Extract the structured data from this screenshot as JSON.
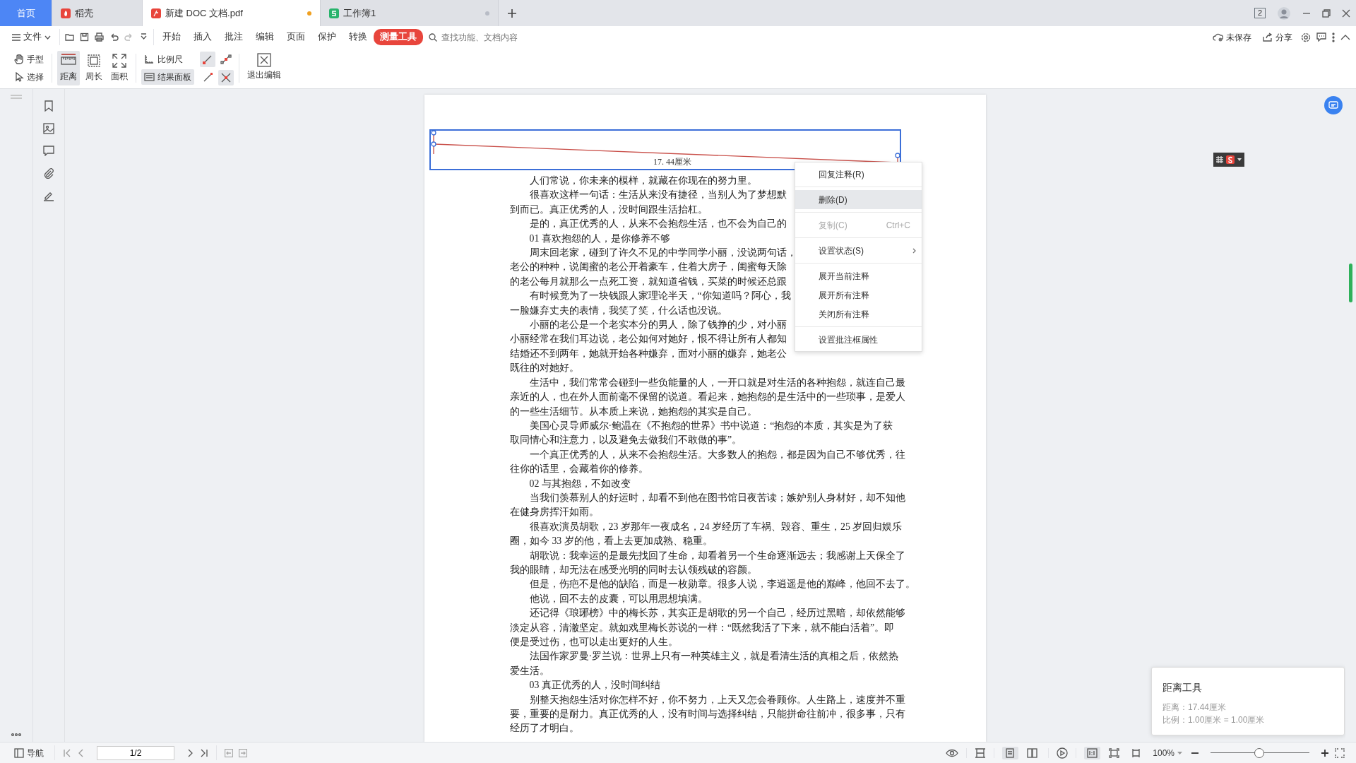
{
  "tabs": [
    {
      "label": "首页",
      "kind": "home",
      "selected": false,
      "unsaved": false
    },
    {
      "label": "稻壳",
      "kind": "docer",
      "selected": false,
      "unsaved": false
    },
    {
      "label": "新建 DOC 文档.pdf",
      "kind": "pdf",
      "selected": true,
      "unsaved": true
    },
    {
      "label": "工作簿1",
      "kind": "sheet",
      "selected": false,
      "unsaved": true
    }
  ],
  "window": {
    "count": "2"
  },
  "menu": {
    "file": "文件",
    "items": [
      {
        "label": "开始",
        "selected": false
      },
      {
        "label": "插入",
        "selected": false
      },
      {
        "label": "批注",
        "selected": false
      },
      {
        "label": "编辑",
        "selected": false
      },
      {
        "label": "页面",
        "selected": false
      },
      {
        "label": "保护",
        "selected": false
      },
      {
        "label": "转换",
        "selected": false
      },
      {
        "label": "测量工具",
        "selected": true
      }
    ],
    "search": {
      "placeholder": "查找功能、文档内容"
    },
    "save_state": "未保存",
    "share": "分享"
  },
  "ribbon": {
    "modes": [
      {
        "label": "手型",
        "kind": "hand",
        "selected": false
      },
      {
        "label": "选择",
        "kind": "select",
        "selected": false
      }
    ],
    "tools": [
      {
        "label": "距离",
        "kind": "distance",
        "selected": true
      },
      {
        "label": "周长",
        "kind": "perimeter",
        "selected": false
      },
      {
        "label": "面积",
        "kind": "area",
        "selected": false
      }
    ],
    "options": [
      {
        "label": "比例尺",
        "kind": "scale",
        "selected": false
      },
      {
        "label": "结果面板",
        "kind": "panel",
        "selected": true
      }
    ],
    "snaps": [
      {
        "kind": "endpoint",
        "selected": true
      },
      {
        "kind": "midpoint",
        "selected": false
      },
      {
        "kind": "path",
        "selected": false
      },
      {
        "kind": "intersection",
        "selected": true
      }
    ],
    "exit": "退出编辑"
  },
  "document": {
    "measurement": {
      "label": "17. 44厘米"
    },
    "paragraphs": [
      {
        "lines": [
          "人们常说，你未来的模样，就藏在你现在的努力里。"
        ]
      },
      {
        "lines": [
          "很喜欢这样一句话：生活从来没有捷径，当别人为了梦想默",
          "到而已。真正优秀的人，没时间跟生活抬杠。"
        ]
      },
      {
        "lines": [
          "是的，真正优秀的人，从来不会抱怨生活，也不会为自己的"
        ]
      },
      {
        "lines": [
          "01  喜欢抱怨的人，是你修养不够"
        ]
      },
      {
        "lines": [
          "周末回老家，碰到了许久不见的中学同学小丽，没说两句话，",
          "老公的种种，说闺蜜的老公开着豪车，住着大房子，闺蜜每天除",
          "的老公每月就那么一点死工资，就知道省钱，买菜的时候还总跟"
        ]
      },
      {
        "lines": [
          "有时候竟为了一块钱跟人家理论半天，“你知道吗？阿心，我",
          "一脸嫌弃丈夫的表情，我笑了笑，什么话也没说。"
        ]
      },
      {
        "lines": [
          "小丽的老公是一个老实本分的男人，除了钱挣的少，对小丽",
          "小丽经常在我们耳边说，老公如何对她好，恨不得让所有人都知",
          "结婚还不到两年，她就开始各种嫌弃，面对小丽的嫌弃，她老公",
          "既往的对她好。"
        ]
      },
      {
        "lines": [
          "生活中，我们常常会碰到一些负能量的人，一开口就是对生活的各种抱怨，就连自己最",
          "亲近的人，也在外人面前毫不保留的说道。看起来，她抱怨的是生活中的一些琐事，是爱人",
          "的一些生活细节。从本质上来说，她抱怨的其实是自己。"
        ]
      },
      {
        "lines": [
          "美国心灵导师威尔·鲍温在《不抱怨的世界》书中说道：“抱怨的本质，其实是为了获",
          "取同情心和注意力，以及避免去做我们不敢做的事”。"
        ]
      },
      {
        "lines": [
          "一个真正优秀的人，从来不会抱怨生活。大多数人的抱怨，都是因为自己不够优秀，往",
          "往你的话里，会藏着你的修养。"
        ]
      },
      {
        "lines": [
          "02  与其抱怨，不如改变"
        ]
      },
      {
        "lines": [
          "当我们羡慕别人的好运时，却看不到他在图书馆日夜苦读；嫉妒别人身材好，却不知他",
          "在健身房挥汗如雨。"
        ]
      },
      {
        "lines": [
          "很喜欢演员胡歌，23 岁那年一夜成名，24 岁经历了车祸、毁容、重生，25 岁回归娱乐",
          "圈，如今 33 岁的他，看上去更加成熟、稳重。"
        ]
      },
      {
        "lines": [
          "胡歌说：我幸运的是最先找回了生命，却看着另一个生命逐渐远去；我感谢上天保全了",
          "我的眼睛，却无法在感受光明的同时去认领残破的容颜。"
        ]
      },
      {
        "lines": [
          "但是，伤疤不是他的缺陷，而是一枚勋章。很多人说，李逍遥是他的巅峰，他回不去了。"
        ]
      },
      {
        "lines": [
          "他说，回不去的皮囊，可以用思想填满。"
        ]
      },
      {
        "lines": [
          "还记得《琅琊榜》中的梅长苏，其实正是胡歌的另一个自己，经历过黑暗，却依然能够",
          "淡定从容，清澈坚定。就如戏里梅长苏说的一样：“既然我活了下来，就不能白活着”。即",
          "便是受过伤，也可以走出更好的人生。"
        ]
      },
      {
        "lines": [
          "法国作家罗曼·罗兰说：世界上只有一种英雄主义，就是看清生活的真相之后，依然热",
          "爱生活。"
        ]
      },
      {
        "lines": [
          "03  真正优秀的人，没时间纠结"
        ]
      },
      {
        "lines": [
          "别整天抱怨生活对你怎样不好，你不努力，上天又怎会眷顾你。人生路上，速度并不重",
          "要，重要的是耐力。真正优秀的人，没有时间与选择纠结，只能拼命往前冲，很多事，只有",
          "经历了才明白。"
        ]
      }
    ]
  },
  "context_menu": {
    "groups": [
      [
        {
          "label": "回复注释(R)",
          "selected": false,
          "disabled": false,
          "submenu": false
        }
      ],
      [
        {
          "label": "删除(D)",
          "selected": true,
          "disabled": false,
          "submenu": false
        }
      ],
      [
        {
          "label": "复制(C)",
          "shortcut": "Ctrl+C",
          "selected": false,
          "disabled": true,
          "submenu": false
        }
      ],
      [
        {
          "label": "设置状态(S)",
          "selected": false,
          "disabled": false,
          "submenu": true
        }
      ],
      [
        {
          "label": "展开当前注释",
          "selected": false,
          "disabled": false,
          "submenu": false
        },
        {
          "label": "展开所有注释",
          "selected": false,
          "disabled": false,
          "submenu": false
        },
        {
          "label": "关闭所有注释",
          "selected": false,
          "disabled": false,
          "submenu": false
        }
      ],
      [
        {
          "label": "设置批注框属性",
          "selected": false,
          "disabled": false,
          "submenu": false
        }
      ]
    ]
  },
  "result_panel": {
    "title": "距离工具",
    "distance": "距离：17.44厘米",
    "scale": "比例：1.00厘米 = 1.00厘米"
  },
  "status_bar": {
    "nav": "导航",
    "page": "1/2",
    "zoom": "100%",
    "zoom_slider": {
      "level": 0.49
    },
    "layouts": [
      {
        "kind": "single",
        "selected": true
      },
      {
        "kind": "double",
        "selected": false
      }
    ],
    "fits": [
      {
        "kind": "actual",
        "selected": true
      },
      {
        "kind": "page",
        "selected": false
      },
      {
        "kind": "width",
        "selected": false
      }
    ]
  }
}
